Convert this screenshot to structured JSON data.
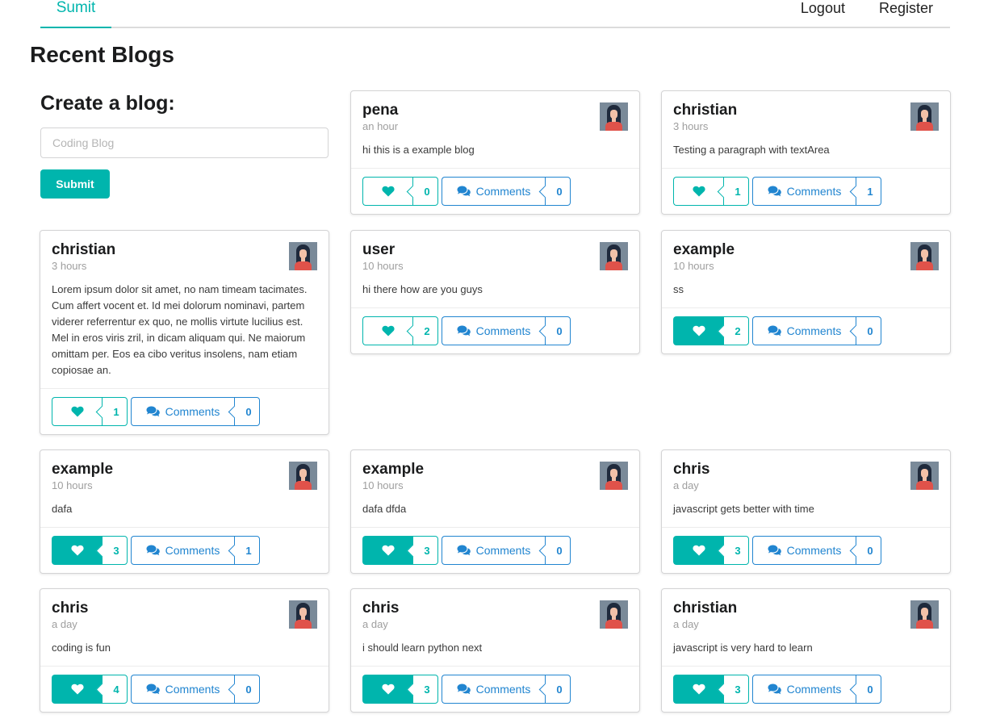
{
  "nav": {
    "brand": "Sumit",
    "logout": "Logout",
    "register": "Register"
  },
  "page_title": "Recent Blogs",
  "create": {
    "title": "Create a blog:",
    "placeholder": "Coding Blog",
    "submit": "Submit"
  },
  "colors": {
    "teal": "#00b5ad",
    "blue": "#2185d0"
  },
  "icons": {
    "like": "heart-icon",
    "comment": "comments-icon",
    "avatar": "avatar-image"
  },
  "comment_label": "Comments",
  "posts": [
    {
      "author": "pena",
      "time": "an hour",
      "body": "hi this is a example blog",
      "likes": "0",
      "liked": false,
      "comments": "0"
    },
    {
      "author": "christian",
      "time": "3 hours",
      "body": "Testing a paragraph with textArea",
      "likes": "1",
      "liked": false,
      "comments": "1"
    },
    {
      "author": "christian",
      "time": "3 hours",
      "body": "Lorem ipsum dolor sit amet, no nam timeam tacimates. Cum affert vocent et. Id mei dolorum nominavi, partem viderer referrentur ex quo, ne mollis virtute lucilius est. Mel in eros viris zril, in dicam aliquam qui. Ne maiorum omittam per. Eos ea cibo veritus insolens, nam etiam copiosae an.",
      "likes": "1",
      "liked": false,
      "comments": "0"
    },
    {
      "author": "user",
      "time": "10 hours",
      "body": "hi there how are you guys",
      "likes": "2",
      "liked": false,
      "comments": "0"
    },
    {
      "author": "example",
      "time": "10 hours",
      "body": "ss",
      "likes": "2",
      "liked": true,
      "comments": "0"
    },
    {
      "author": "example",
      "time": "10 hours",
      "body": "dafa",
      "likes": "3",
      "liked": true,
      "comments": "1"
    },
    {
      "author": "example",
      "time": "10 hours",
      "body": "dafa dfda",
      "likes": "3",
      "liked": true,
      "comments": "0"
    },
    {
      "author": "chris",
      "time": "a day",
      "body": "javascript gets better with time",
      "likes": "3",
      "liked": true,
      "comments": "0"
    },
    {
      "author": "chris",
      "time": "a day",
      "body": "coding is fun",
      "likes": "4",
      "liked": true,
      "comments": "0"
    },
    {
      "author": "chris",
      "time": "a day",
      "body": "i should learn python next",
      "likes": "3",
      "liked": true,
      "comments": "0"
    },
    {
      "author": "christian",
      "time": "a day",
      "body": "javascript is very hard to learn",
      "likes": "3",
      "liked": true,
      "comments": "0"
    }
  ]
}
